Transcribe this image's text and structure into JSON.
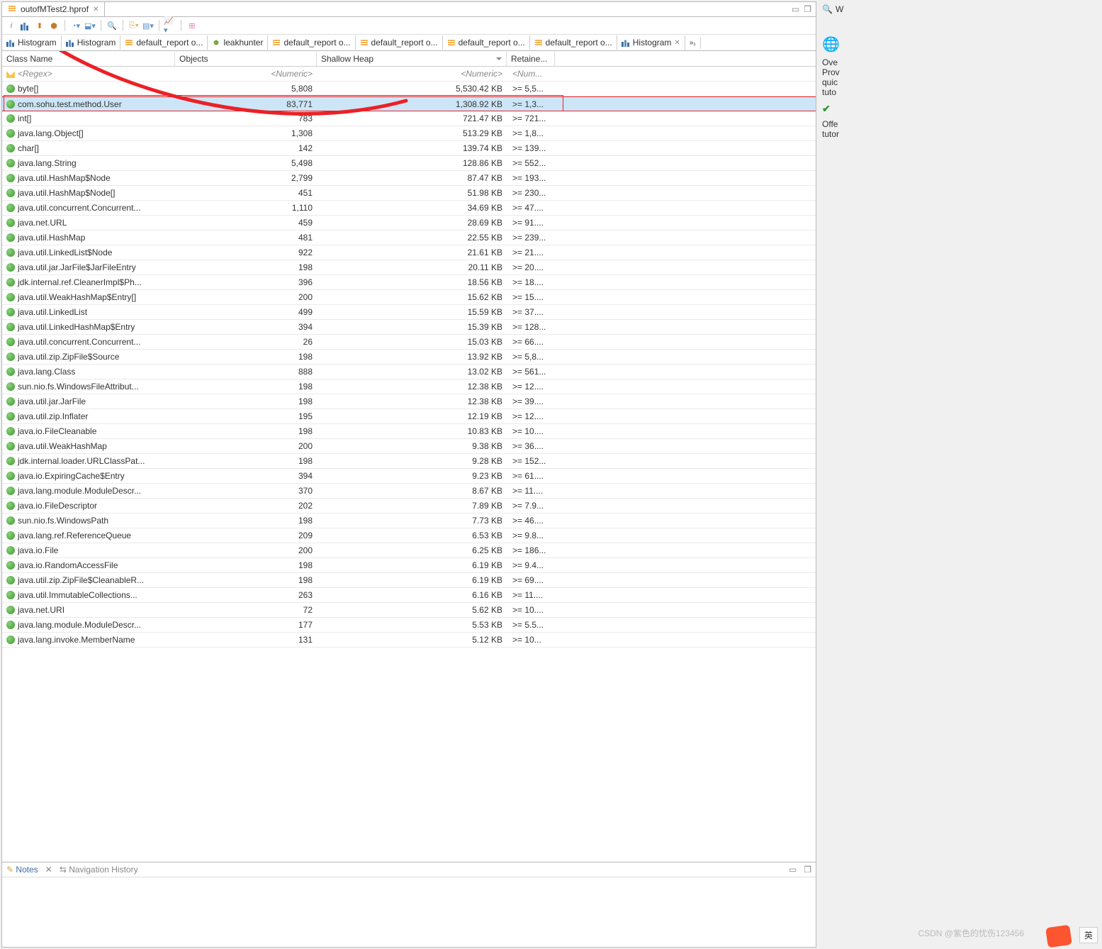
{
  "fileTab": {
    "title": "outofMTest2.hprof"
  },
  "toolbarItems": [
    "i",
    "bar",
    "hist",
    "tree",
    "dom",
    "pie",
    "arrow",
    "sep",
    "qbe",
    "sep",
    "zoom",
    "sep",
    "copy",
    "arrow",
    "tab",
    "arrow",
    "sep",
    "chart",
    "arrow",
    "sep",
    "grid"
  ],
  "tabs": [
    {
      "label": "Histogram",
      "icon": "bar"
    },
    {
      "label": "Histogram",
      "icon": "bar"
    },
    {
      "label": "default_report  o...",
      "icon": "stack"
    },
    {
      "label": "leakhunter",
      "icon": "leak"
    },
    {
      "label": "default_report  o...",
      "icon": "stack"
    },
    {
      "label": "default_report  o...",
      "icon": "stack"
    },
    {
      "label": "default_report  o...",
      "icon": "stack"
    },
    {
      "label": "default_report  o...",
      "icon": "stack"
    },
    {
      "label": "Histogram",
      "icon": "bar",
      "close": true
    }
  ],
  "columns": {
    "name": "Class Name",
    "objects": "Objects",
    "shallow": "Shallow Heap",
    "retained": "Retaine..."
  },
  "regex": {
    "name": "<Regex>",
    "objects": "<Numeric>",
    "shallow": "<Numeric>",
    "retained": "<Num..."
  },
  "rows": [
    {
      "name": "byte[]",
      "objects": "5,808",
      "shallow": "5,530.42 KB",
      "retained": ">= 5,5..."
    },
    {
      "name": "com.sohu.test.method.User",
      "objects": "83,771",
      "shallow": "1,308.92 KB",
      "retained": ">= 1,3...",
      "selected": true
    },
    {
      "name": "int[]",
      "objects": "783",
      "shallow": "721.47 KB",
      "retained": ">= 721..."
    },
    {
      "name": "java.lang.Object[]",
      "objects": "1,308",
      "shallow": "513.29 KB",
      "retained": ">= 1,8..."
    },
    {
      "name": "char[]",
      "objects": "142",
      "shallow": "139.74 KB",
      "retained": ">= 139..."
    },
    {
      "name": "java.lang.String",
      "objects": "5,498",
      "shallow": "128.86 KB",
      "retained": ">= 552..."
    },
    {
      "name": "java.util.HashMap$Node",
      "objects": "2,799",
      "shallow": "87.47 KB",
      "retained": ">= 193..."
    },
    {
      "name": "java.util.HashMap$Node[]",
      "objects": "451",
      "shallow": "51.98 KB",
      "retained": ">= 230..."
    },
    {
      "name": "java.util.concurrent.Concurrent...",
      "objects": "1,110",
      "shallow": "34.69 KB",
      "retained": ">= 47...."
    },
    {
      "name": "java.net.URL",
      "objects": "459",
      "shallow": "28.69 KB",
      "retained": ">= 91...."
    },
    {
      "name": "java.util.HashMap",
      "objects": "481",
      "shallow": "22.55 KB",
      "retained": ">= 239..."
    },
    {
      "name": "java.util.LinkedList$Node",
      "objects": "922",
      "shallow": "21.61 KB",
      "retained": ">= 21...."
    },
    {
      "name": "java.util.jar.JarFile$JarFileEntry",
      "objects": "198",
      "shallow": "20.11 KB",
      "retained": ">= 20...."
    },
    {
      "name": "jdk.internal.ref.CleanerImpl$Ph...",
      "objects": "396",
      "shallow": "18.56 KB",
      "retained": ">= 18...."
    },
    {
      "name": "java.util.WeakHashMap$Entry[]",
      "objects": "200",
      "shallow": "15.62 KB",
      "retained": ">= 15...."
    },
    {
      "name": "java.util.LinkedList",
      "objects": "499",
      "shallow": "15.59 KB",
      "retained": ">= 37...."
    },
    {
      "name": "java.util.LinkedHashMap$Entry",
      "objects": "394",
      "shallow": "15.39 KB",
      "retained": ">= 128..."
    },
    {
      "name": "java.util.concurrent.Concurrent...",
      "objects": "26",
      "shallow": "15.03 KB",
      "retained": ">= 66...."
    },
    {
      "name": "java.util.zip.ZipFile$Source",
      "objects": "198",
      "shallow": "13.92 KB",
      "retained": ">= 5,8..."
    },
    {
      "name": "java.lang.Class",
      "objects": "888",
      "shallow": "13.02 KB",
      "retained": ">= 561..."
    },
    {
      "name": "sun.nio.fs.WindowsFileAttribut...",
      "objects": "198",
      "shallow": "12.38 KB",
      "retained": ">= 12...."
    },
    {
      "name": "java.util.jar.JarFile",
      "objects": "198",
      "shallow": "12.38 KB",
      "retained": ">= 39...."
    },
    {
      "name": "java.util.zip.Inflater",
      "objects": "195",
      "shallow": "12.19 KB",
      "retained": ">= 12...."
    },
    {
      "name": "java.io.FileCleanable",
      "objects": "198",
      "shallow": "10.83 KB",
      "retained": ">= 10...."
    },
    {
      "name": "java.util.WeakHashMap",
      "objects": "200",
      "shallow": "9.38 KB",
      "retained": ">= 36...."
    },
    {
      "name": "jdk.internal.loader.URLClassPat...",
      "objects": "198",
      "shallow": "9.28 KB",
      "retained": ">= 152..."
    },
    {
      "name": "java.io.ExpiringCache$Entry",
      "objects": "394",
      "shallow": "9.23 KB",
      "retained": ">= 61...."
    },
    {
      "name": "java.lang.module.ModuleDescr...",
      "objects": "370",
      "shallow": "8.67 KB",
      "retained": ">= 11...."
    },
    {
      "name": "java.io.FileDescriptor",
      "objects": "202",
      "shallow": "7.89 KB",
      "retained": ">= 7.9..."
    },
    {
      "name": "sun.nio.fs.WindowsPath",
      "objects": "198",
      "shallow": "7.73 KB",
      "retained": ">= 46...."
    },
    {
      "name": "java.lang.ref.ReferenceQueue",
      "objects": "209",
      "shallow": "6.53 KB",
      "retained": ">= 9.8..."
    },
    {
      "name": "java.io.File",
      "objects": "200",
      "shallow": "6.25 KB",
      "retained": ">= 186..."
    },
    {
      "name": "java.io.RandomAccessFile",
      "objects": "198",
      "shallow": "6.19 KB",
      "retained": ">= 9.4..."
    },
    {
      "name": "java.util.zip.ZipFile$CleanableR...",
      "objects": "198",
      "shallow": "6.19 KB",
      "retained": ">= 69...."
    },
    {
      "name": "java.util.ImmutableCollections...",
      "objects": "263",
      "shallow": "6.16 KB",
      "retained": ">= 11...."
    },
    {
      "name": "java.net.URI",
      "objects": "72",
      "shallow": "5.62 KB",
      "retained": ">= 10...."
    },
    {
      "name": "java.lang.module.ModuleDescr...",
      "objects": "177",
      "shallow": "5.53 KB",
      "retained": ">= 5.5..."
    },
    {
      "name": "java.lang.invoke.MemberName",
      "objects": "131",
      "shallow": "5.12 KB",
      "retained": ">= 10..."
    }
  ],
  "notes": {
    "tab1": "Notes",
    "tab2": "Navigation History"
  },
  "side": {
    "w": "W",
    "ove": "Ove",
    "prov": "Prov",
    "quic": "quic",
    "tuto": "tuto",
    "offe": "Offe",
    "tutor": "tutor"
  },
  "watermark": "CSDN @紫色的忧伤123456",
  "imeLabel": "英"
}
